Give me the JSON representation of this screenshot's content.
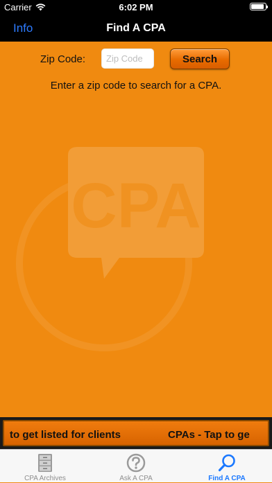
{
  "status_bar": {
    "carrier": "Carrier",
    "time": "6:02 PM",
    "battery_level": 0.9
  },
  "nav": {
    "left_button": "Info",
    "title": "Find A CPA"
  },
  "search": {
    "zip_label": "Zip Code:",
    "zip_placeholder": "Zip Code",
    "zip_value": "",
    "search_button": "Search",
    "instruction": "Enter a zip code to search for a CPA."
  },
  "watermark": {
    "text": "CPA",
    "icon": "speech-bubble-cpa-logo"
  },
  "banner": {
    "text_part_1": "to get listed for clients",
    "text_part_2": "CPAs - Tap to ge"
  },
  "tabs": [
    {
      "label": "CPA Archives",
      "icon": "file-cabinet-icon"
    },
    {
      "label": "Ask A CPA",
      "icon": "question-mark-icon"
    },
    {
      "label": "Find A CPA",
      "icon": "magnifier-icon"
    }
  ],
  "colors": {
    "background": "#f08a10",
    "bars": "#000000",
    "nav_link": "#2d7bff",
    "tab_active": "#1a78ff",
    "tab_inactive": "#8e8e8e"
  }
}
